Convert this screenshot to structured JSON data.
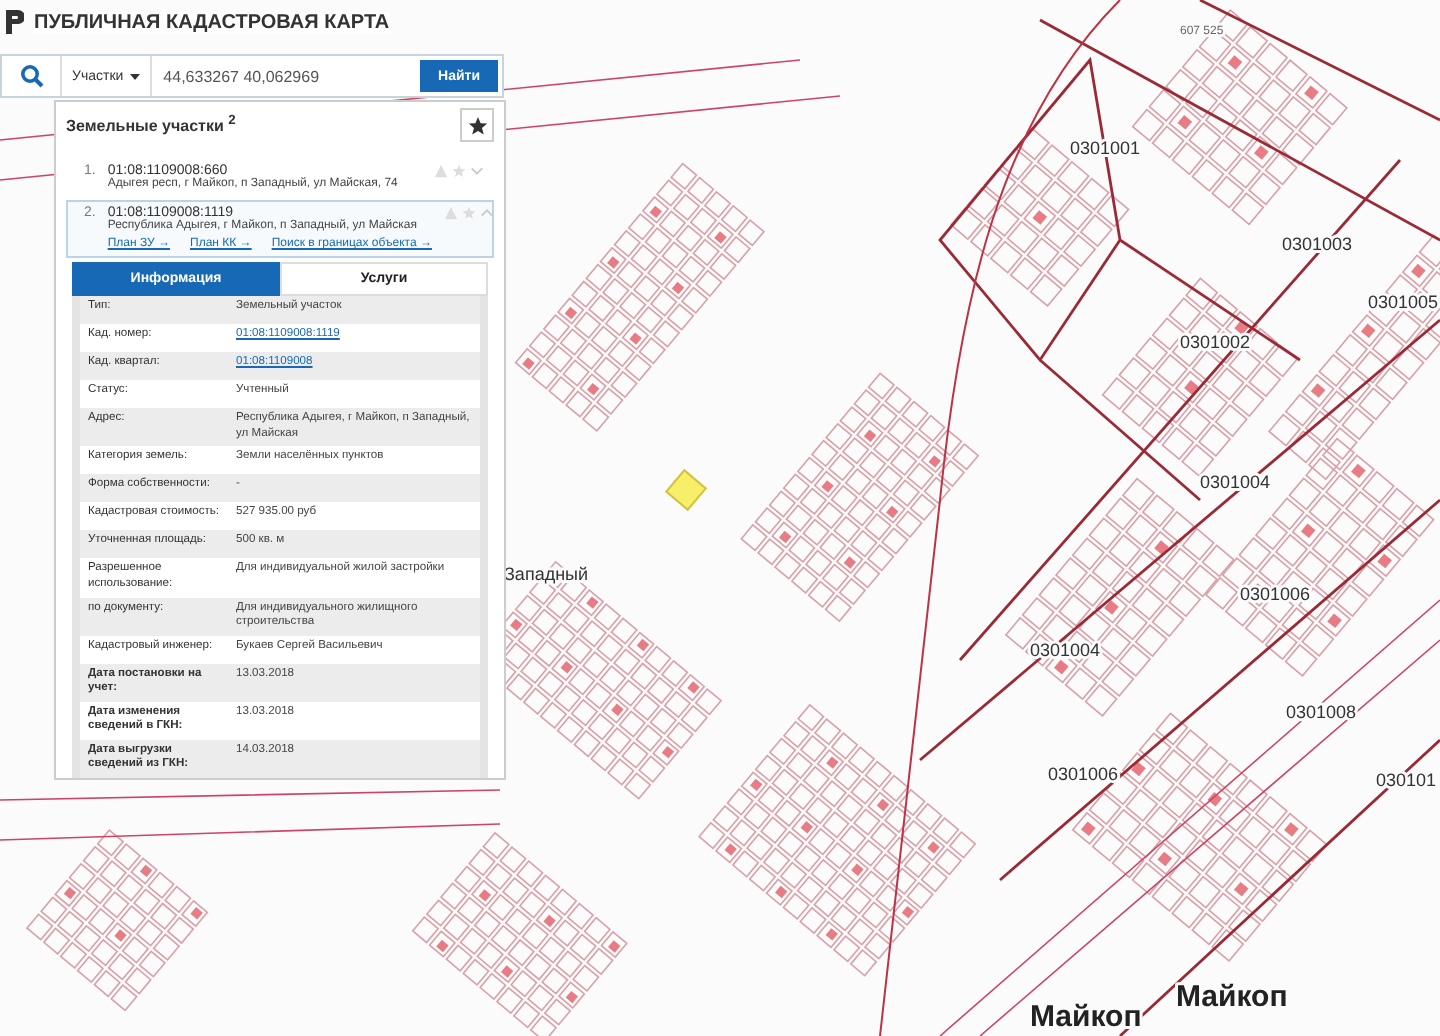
{
  "header": {
    "title": "ПУБЛИЧНАЯ КАДАСТРОВАЯ КАРТА"
  },
  "search": {
    "type_select": "Участки",
    "value": "44,633267 40,062969",
    "button": "Найти"
  },
  "results": {
    "heading": "Земельные участки $^{2}$",
    "items": [
      {
        "number": "1.",
        "cad_number": "01:08:1109008:660",
        "address": "Адыгея респ, г Майкоп, п Западный, ул Майская, 74",
        "selected": false
      },
      {
        "number": "2.",
        "cad_number": "01:08:1109008:1119",
        "address": "Республика Адыгея, г Майкоп, п Западный, ул Майская",
        "selected": true,
        "links": [
          "План ЗУ →",
          "План КК →",
          "Поиск в границах объекта →"
        ]
      }
    ]
  },
  "tabs": [
    {
      "label": "Информация",
      "selected": true
    },
    {
      "label": "Услуги",
      "selected": false
    }
  ],
  "info_rows": [
    {
      "label": "Тип:",
      "value": "Земельный участок",
      "kind": "text"
    },
    {
      "label": "Кад. номер:",
      "value": "01:08:1109008:1119",
      "kind": "link"
    },
    {
      "label": "Кад. квартал:",
      "value": "01:08:1109008",
      "kind": "link"
    },
    {
      "label": "Статус:",
      "value": "Учтенный",
      "kind": "text"
    },
    {
      "label": "Адрес:",
      "value": "Республика Адыгея, г Майкоп, п Западный, ул Майская",
      "kind": "text"
    },
    {
      "label": "Категория земель:",
      "value": "Земли населённых пунктов",
      "kind": "text"
    },
    {
      "label": "Форма собственности:",
      "value": "-",
      "kind": "text"
    },
    {
      "label": "Кадастровая стоимость:",
      "value": "527 935.00 руб",
      "kind": "text"
    },
    {
      "label": "Уточненная площадь:",
      "value": "500 кв. м",
      "kind": "text"
    },
    {
      "label": "Разрешенное использование:",
      "value": "Для индивидуальной жилой застройки",
      "kind": "text"
    },
    {
      "label": "по документу:",
      "value": "Для индивидуального жилищного строительства",
      "kind": "text"
    },
    {
      "label": "Кадастровый инженер:",
      "value": "Букаев Сергей Васильевич",
      "kind": "text"
    },
    {
      "label": "Дата постановки на учет:",
      "value": "13.03.2018",
      "kind": "date"
    },
    {
      "label": "Дата изменения сведений в ГКН:",
      "value": "13.03.2018",
      "kind": "date"
    },
    {
      "label": "Дата выгрузки сведений из ГКН:",
      "value": "14.03.2018",
      "kind": "date"
    }
  ],
  "map": {
    "labels": [
      {
        "text": "607 525",
        "kind": "number"
      },
      {
        "text": "0301001",
        "kind": "quarter"
      },
      {
        "text": "0301003",
        "kind": "quarter"
      },
      {
        "text": "0301005",
        "kind": "quarter"
      },
      {
        "text": "0301002",
        "kind": "quarter"
      },
      {
        "text": "0301004",
        "kind": "quarter"
      },
      {
        "text": "0301006",
        "kind": "quarter"
      },
      {
        "text": "0301004",
        "kind": "quarter"
      },
      {
        "text": "0301008",
        "kind": "quarter"
      },
      {
        "text": "0301006",
        "kind": "quarter"
      },
      {
        "text": "030101",
        "kind": "quarter"
      },
      {
        "text": "Западный",
        "kind": "district"
      },
      {
        "text": "Майкоп",
        "kind": "city"
      },
      {
        "text": "Майкоп",
        "kind": "city"
      }
    ]
  }
}
